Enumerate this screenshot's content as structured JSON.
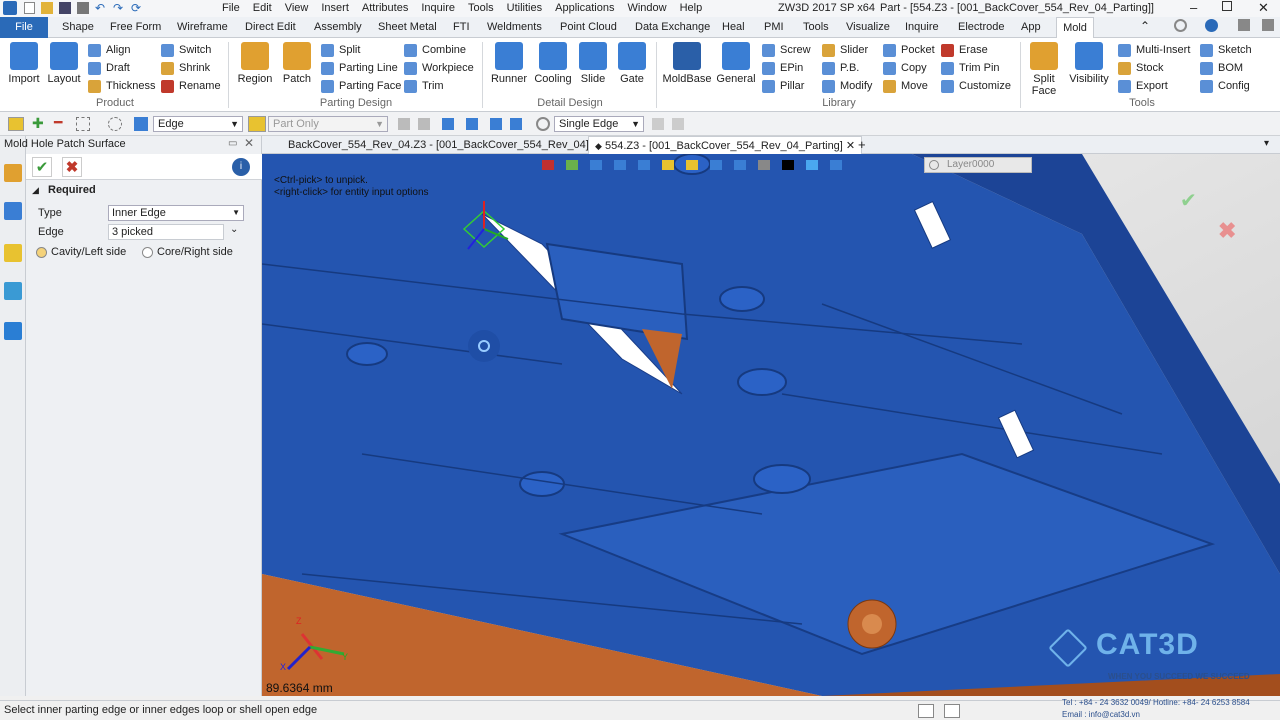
{
  "titlebar": {
    "menu": [
      "File",
      "Edit",
      "View",
      "Insert",
      "Attributes",
      "Inquire",
      "Tools",
      "Utilities",
      "Applications",
      "Window",
      "Help"
    ],
    "app_title": "ZW3D 2017 SP x64",
    "doc_title": "Part - [554.Z3 - [001_BackCover_554_Rev_04_Parting]]"
  },
  "ribbon_tabs": {
    "file": "File",
    "tabs": [
      "Shape",
      "Free Form",
      "Wireframe",
      "Direct Edit",
      "Assembly",
      "Sheet Metal",
      "FTI",
      "Weldments",
      "Point Cloud",
      "Data Exchange",
      "Heal",
      "PMI",
      "Tools",
      "Visualize",
      "Inquire",
      "Electrode",
      "App"
    ],
    "active": "Mold"
  },
  "ribbon": {
    "product": {
      "label": "Product",
      "big": [
        "Import",
        "Layout"
      ],
      "small": [
        "Align",
        "Draft",
        "Thickness",
        "Switch",
        "Shrink",
        "Rename"
      ]
    },
    "parting": {
      "label": "Parting Design",
      "big": [
        "Region",
        "Patch"
      ],
      "small": [
        "Split",
        "Parting Line",
        "Parting Face",
        "Combine",
        "Workpiece",
        "Trim"
      ]
    },
    "detail": {
      "label": "Detail Design",
      "big": [
        "Runner",
        "Cooling",
        "Slide",
        "Gate"
      ]
    },
    "library": {
      "label": "Library",
      "big": [
        "MoldBase",
        "General"
      ],
      "small": [
        "Screw",
        "EPin",
        "Pillar",
        "Slider",
        "P.B.",
        "Modify",
        "Pocket",
        "Copy",
        "Move",
        "Erase",
        "Trim Pin",
        "Customize"
      ]
    },
    "tools": {
      "label": "Tools",
      "big": [
        "Split Face",
        "Visibility"
      ],
      "small": [
        "Multi-Insert",
        "Stock",
        "Export",
        "Sketch",
        "BOM",
        "Config"
      ]
    }
  },
  "toolbar2": {
    "filter": "Edge",
    "part": "Part Only",
    "pick": "Single Edge"
  },
  "panel": {
    "title": "Mold Hole Patch Surface",
    "section": "Required",
    "type_label": "Type",
    "type_value": "Inner Edge",
    "edge_label": "Edge",
    "edge_value": "3 picked",
    "radio1": "Cavity/Left side",
    "radio2": "Core/Right side"
  },
  "doctabs": {
    "tab1": "BackCover_554_Rev_04.Z3 - [001_BackCover_554_Rev_04]",
    "tab2": "554.Z3 - [001_BackCover_554_Rev_04_Parting]"
  },
  "viewport": {
    "hint1": "<Ctrl-pick> to unpick.",
    "hint2": "<right-click> for entity input options",
    "layer": "Layer0000",
    "scale": "89.6364 mm",
    "axis_x": "X",
    "axis_y": "Y",
    "axis_z": "Z"
  },
  "watermark": {
    "brand": "CAT3D",
    "slogan": "WHEN YOU SUCCEED WE SUCCEED",
    "tel": "Tel : +84 - 24 3632 0049/ Hotline: +84- 24 6253 8584",
    "email": "Email : info@cat3d.vn"
  },
  "status": {
    "prompt": "Select inner parting edge or inner edges loop or shell open edge"
  },
  "colors": {
    "model_blue": "#2455b0",
    "core_orange": "#c0652d",
    "ribbon_accent": "#2a6ab8"
  }
}
